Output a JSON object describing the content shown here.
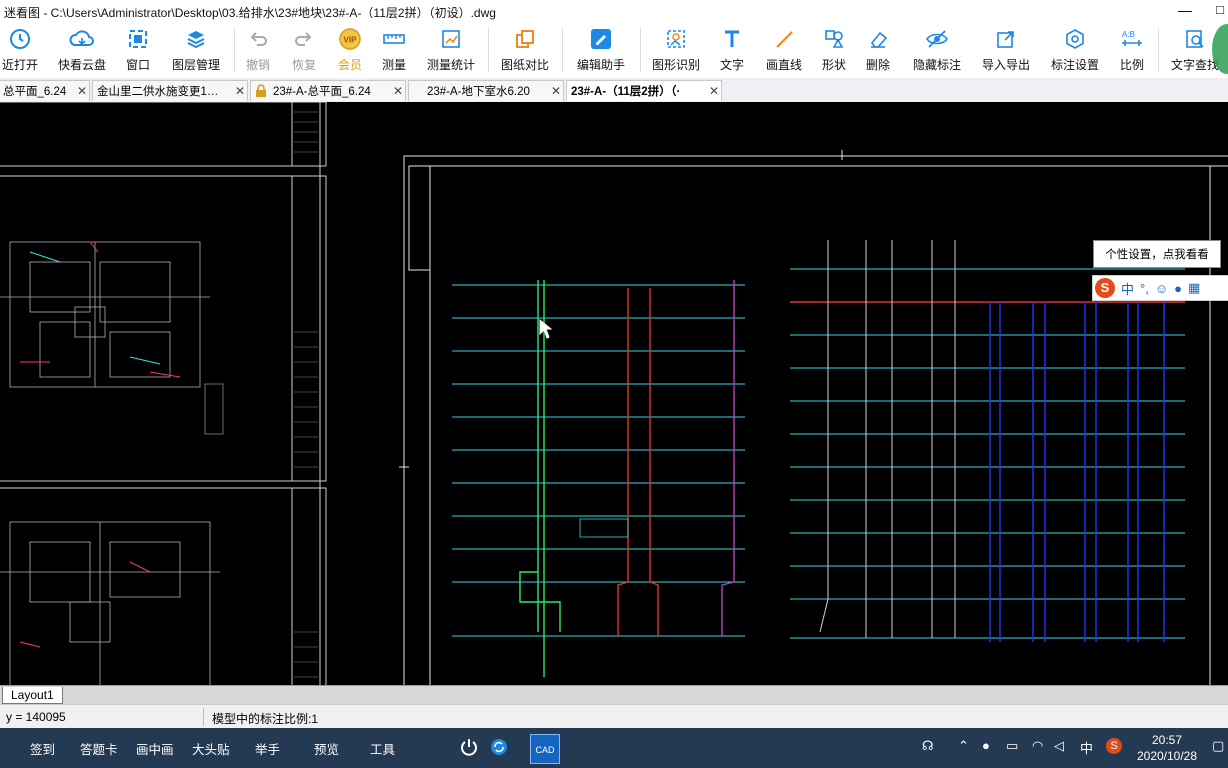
{
  "titlebar": {
    "title": "迷看图 - C:\\Users\\Administrator\\Desktop\\03.给排水\\23#地块\\23#-A-（11层2拼）（初设）.dwg",
    "min_glyph": "—",
    "max_glyph": "□"
  },
  "toolbar": {
    "recent": "近打开",
    "cloud": "快看云盘",
    "window": "窗口",
    "layers": "图层管理",
    "undo": "撤销",
    "redo": "恢复",
    "vip": "会员",
    "measure": "测量",
    "measure_stats": "测量统计",
    "compare": "图纸对比",
    "edit_assistant": "编辑助手",
    "shape_recognize": "图形识别",
    "text": "文字",
    "line": "画直线",
    "shape": "形状",
    "delete": "删除",
    "hide_marks": "隐藏标注",
    "import_export": "导入导出",
    "mark_settings": "标注设置",
    "scale": "比例",
    "text_search": "文字查找"
  },
  "tabs": [
    {
      "label": "总平面_6.24",
      "locked": false
    },
    {
      "label": "金山里二供水施变更1…",
      "locked": false
    },
    {
      "label": "23#-A-总平面_6.24",
      "locked": true
    },
    {
      "label": "23#-A-地下室水6.20",
      "locked": false
    },
    {
      "label": "23#-A-（11层2拼）（·",
      "locked": false,
      "active": true
    }
  ],
  "tab_close_glyph": "✕",
  "tooltip": "个性设置，点我看看",
  "ime": {
    "logo": "S",
    "mode": "中",
    "punct": "°,"
  },
  "layout_tab": "Layout1",
  "status": {
    "coord": "y = 140095",
    "scale_text": "模型中的标注比例:1"
  },
  "taskbar": {
    "items": [
      "签到",
      "答题卡",
      "画中画",
      "大头贴",
      "举手",
      "预览",
      "工具"
    ],
    "input_lang": "中",
    "time": "20:57",
    "date": "2020/10/28"
  },
  "colors": {
    "cad_bg": "#000000",
    "pipe_green": "#2ee86a",
    "pipe_red": "#e0332a",
    "pipe_cyan": "#38d6e0",
    "pipe_blue": "#2233ff",
    "pipe_magenta": "#b040c0",
    "taskbar": "#243a52"
  }
}
